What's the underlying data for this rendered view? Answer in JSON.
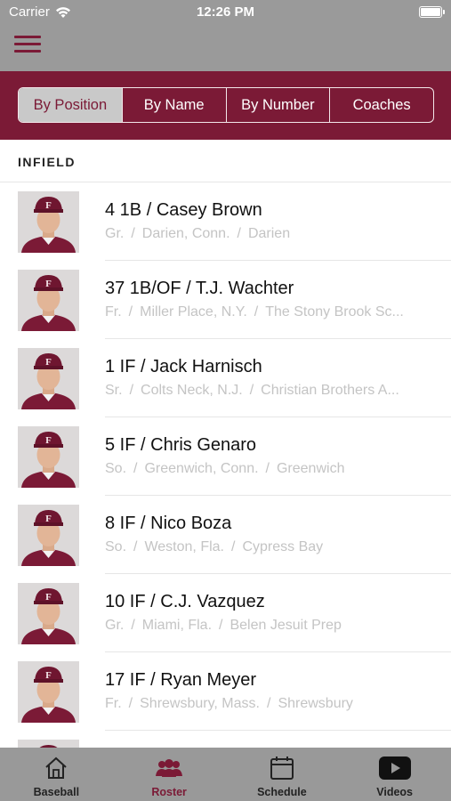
{
  "status_bar": {
    "carrier": "Carrier",
    "time": "12:26 PM"
  },
  "nav": {
    "menu_icon": "hamburger-menu-icon"
  },
  "segmented": {
    "options": [
      "By Position",
      "By Name",
      "By Number",
      "Coaches"
    ],
    "selected": "By Position"
  },
  "section": {
    "title": "INFIELD"
  },
  "players": [
    {
      "title": "4 1B / Casey Brown",
      "year": "Gr.",
      "hometown": "Darien, Conn.",
      "school": "Darien"
    },
    {
      "title": "37 1B/OF / T.J. Wachter",
      "year": "Fr.",
      "hometown": "Miller Place, N.Y.",
      "school": "The Stony Brook Sc..."
    },
    {
      "title": "1 IF / Jack Harnisch",
      "year": "Sr.",
      "hometown": "Colts Neck, N.J.",
      "school": "Christian Brothers A..."
    },
    {
      "title": "5 IF / Chris Genaro",
      "year": "So.",
      "hometown": "Greenwich, Conn.",
      "school": "Greenwich"
    },
    {
      "title": "8 IF / Nico Boza",
      "year": "So.",
      "hometown": "Weston, Fla.",
      "school": "Cypress Bay"
    },
    {
      "title": "10 IF / C.J. Vazquez",
      "year": "Gr.",
      "hometown": "Miami, Fla.",
      "school": "Belen Jesuit Prep"
    },
    {
      "title": "17 IF / Ryan Meyer",
      "year": "Fr.",
      "hometown": "Shrewsbury, Mass.",
      "school": "Shrewsbury"
    }
  ],
  "separator": "/",
  "tabs": [
    {
      "label": "Baseball",
      "icon": "home-icon"
    },
    {
      "label": "Roster",
      "icon": "roster-people-icon"
    },
    {
      "label": "Schedule",
      "icon": "calendar-icon"
    },
    {
      "label": "Videos",
      "icon": "youtube-play-icon"
    }
  ],
  "active_tab": "Roster",
  "colors": {
    "brand": "#7b1a36",
    "header_gray": "#9a9a9a",
    "tabbar_gray": "#999999",
    "meta_text": "#c4c4c4"
  }
}
